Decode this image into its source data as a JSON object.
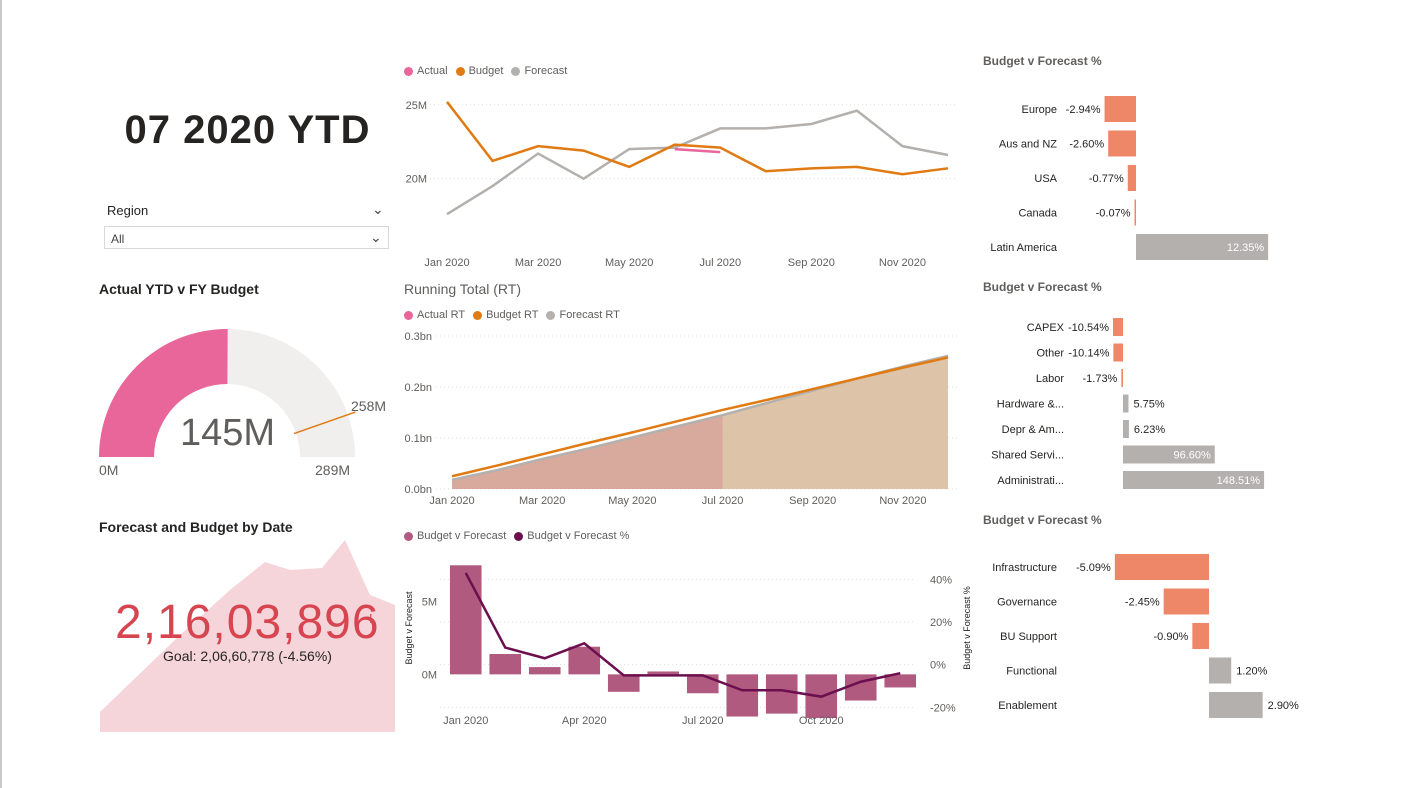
{
  "header": {
    "title": "07 2020 YTD"
  },
  "slicer": {
    "label": "Region",
    "value": "All"
  },
  "gauge": {
    "title": "Actual YTD v FY Budget",
    "value_label": "145M",
    "min_label": "0M",
    "max_label": "289M",
    "target_label": "258M",
    "value": 145,
    "max": 289,
    "target": 258,
    "color_fill": "#e8669a",
    "color_track": "#f0efee",
    "color_target": "#e07a12"
  },
  "kpi": {
    "title": "Forecast and Budget by Date",
    "value": "2,16,03,896",
    "indicator": "!",
    "goal": "Goal: 2,06,60,778 (-4.56%)",
    "color": "#d64550",
    "bg_color": "#f5d5da"
  },
  "colors": {
    "actual": "#e8669a",
    "budget": "#e07a12",
    "forecast": "#b3b0ad",
    "negative_bar": "#ee8768",
    "positive_bar": "#b3b0ad",
    "bvf_bar": "#b15a80",
    "bvf_line": "#6b0f4e"
  },
  "chart_data": [
    {
      "type": "line",
      "legend": [
        "Actual",
        "Budget",
        "Forecast"
      ],
      "x_tick_labels": [
        "Jan 2020",
        "Mar 2020",
        "May 2020",
        "Jul 2020",
        "Sep 2020",
        "Nov 2020"
      ],
      "y_tick_labels": [
        "20M",
        "25M"
      ],
      "ylim": [
        17,
        26
      ],
      "x": [
        "Jan 2020",
        "Feb 2020",
        "Mar 2020",
        "Apr 2020",
        "May 2020",
        "Jun 2020",
        "Jul 2020",
        "Aug 2020",
        "Sep 2020",
        "Oct 2020",
        "Nov 2020",
        "Dec 2020"
      ],
      "series": [
        {
          "name": "Actual",
          "values": [
            null,
            null,
            null,
            null,
            null,
            22.0,
            21.8,
            null,
            null,
            null,
            null,
            null
          ]
        },
        {
          "name": "Budget",
          "values": [
            25.2,
            21.2,
            22.2,
            21.9,
            20.8,
            22.3,
            22.1,
            20.5,
            20.7,
            20.8,
            20.3,
            20.7
          ]
        },
        {
          "name": "Forecast",
          "values": [
            17.6,
            19.5,
            21.7,
            20.0,
            22.0,
            22.1,
            23.4,
            23.4,
            23.7,
            24.6,
            22.2,
            21.6
          ]
        }
      ]
    },
    {
      "type": "area",
      "title": "Running Total (RT)",
      "legend": [
        "Actual RT",
        "Budget RT",
        "Forecast RT"
      ],
      "x_tick_labels": [
        "Jan 2020",
        "Mar 2020",
        "May 2020",
        "Jul 2020",
        "Sep 2020",
        "Nov 2020"
      ],
      "y_tick_labels": [
        "0.0bn",
        "0.1bn",
        "0.2bn",
        "0.3bn"
      ],
      "ylim": [
        0,
        0.3
      ],
      "x": [
        "Jan 2020",
        "Feb 2020",
        "Mar 2020",
        "Apr 2020",
        "May 2020",
        "Jun 2020",
        "Jul 2020",
        "Aug 2020",
        "Sep 2020",
        "Oct 2020",
        "Nov 2020",
        "Dec 2020"
      ],
      "series": [
        {
          "name": "Actual RT",
          "values": [
            0.018,
            0.037,
            0.059,
            0.079,
            0.101,
            0.123,
            0.145,
            null,
            null,
            null,
            null,
            null
          ]
        },
        {
          "name": "Budget RT",
          "values": [
            0.025,
            0.046,
            0.068,
            0.09,
            0.111,
            0.133,
            0.155,
            0.175,
            0.196,
            0.217,
            0.238,
            0.258
          ]
        },
        {
          "name": "Forecast RT",
          "values": [
            0.018,
            0.037,
            0.059,
            0.079,
            0.101,
            0.123,
            0.145,
            0.169,
            0.193,
            0.217,
            0.24,
            0.261
          ]
        }
      ]
    },
    {
      "type": "bar",
      "legend": [
        "Budget v Forecast",
        "Budget v Forecast %"
      ],
      "x_tick_labels": [
        "Jan 2020",
        "Apr 2020",
        "Jul 2020",
        "Oct 2020"
      ],
      "y_tick_labels": [
        "0M",
        "5M"
      ],
      "y2_tick_labels": [
        "-20%",
        "0%",
        "20%",
        "40%"
      ],
      "ylabel": "Budget v Forecast",
      "y2label": "Budget v Forecast %",
      "ylim": [
        -3,
        8
      ],
      "y2lim": [
        -25,
        50
      ],
      "x": [
        "Jan 2020",
        "Feb 2020",
        "Mar 2020",
        "Apr 2020",
        "May 2020",
        "Jun 2020",
        "Jul 2020",
        "Aug 2020",
        "Sep 2020",
        "Oct 2020",
        "Nov 2020",
        "Dec 2020"
      ],
      "series": [
        {
          "name": "Budget v Forecast",
          "values": [
            7.5,
            1.4,
            0.5,
            1.9,
            -1.2,
            0.2,
            -1.3,
            -2.9,
            -2.7,
            -3.0,
            -1.8,
            -0.9
          ]
        },
        {
          "name": "Budget v Forecast %",
          "values": [
            43,
            8,
            3,
            10,
            -5,
            null,
            -5,
            -12,
            -12,
            -15,
            -8,
            -4
          ]
        }
      ]
    },
    {
      "type": "bar",
      "title": "Budget v Forecast %",
      "categories": [
        "Europe",
        "Aus and NZ",
        "USA",
        "Canada",
        "Latin America"
      ],
      "values": [
        -2.94,
        -2.6,
        -0.77,
        -0.07,
        12.35
      ],
      "labels": [
        "-2.94%",
        "-2.60%",
        "-0.77%",
        "-0.07%",
        "12.35%"
      ]
    },
    {
      "type": "bar",
      "title": "Budget v Forecast %",
      "categories": [
        "CAPEX",
        "Other",
        "Labor",
        "Hardware &...",
        "Depr & Am...",
        "Shared Servi...",
        "Administrati..."
      ],
      "values": [
        -10.54,
        -10.14,
        -1.73,
        5.75,
        6.23,
        96.6,
        148.51
      ],
      "labels": [
        "-10.54%",
        "-10.14%",
        "-1.73%",
        "5.75%",
        "6.23%",
        "96.60%",
        "148.51%"
      ]
    },
    {
      "type": "bar",
      "title": "Budget v Forecast %",
      "categories": [
        "Infrastructure",
        "Governance",
        "BU Support",
        "Functional",
        "Enablement"
      ],
      "values": [
        -5.09,
        -2.45,
        -0.9,
        1.2,
        2.9
      ],
      "labels": [
        "-5.09%",
        "-2.45%",
        "-0.90%",
        "1.20%",
        "2.90%"
      ]
    }
  ]
}
